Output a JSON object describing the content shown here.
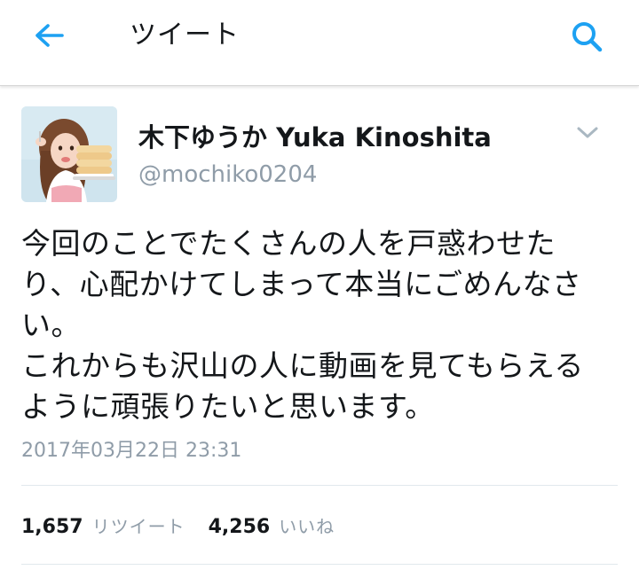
{
  "header": {
    "title": "ツイート",
    "back_icon": "arrow-left-icon",
    "search_icon": "search-icon",
    "accent_color": "#1da1f2"
  },
  "tweet": {
    "display_name": "木下ゆうか Yuka Kinoshita",
    "handle": "@mochiko0204",
    "text_lines": [
      "今回のことでたくさんの人を戸惑わせた",
      "り、心配かけてしまって本当にごめんなさ",
      "い。",
      "これからも沢山の人に動画を見てもらえる",
      "ように頑張りたいと思います。"
    ],
    "timestamp": "2017年03月22日 23:31",
    "retweet_count": "1,657",
    "retweet_label": "リツイート",
    "like_count": "4,256",
    "like_label": "いいね"
  }
}
